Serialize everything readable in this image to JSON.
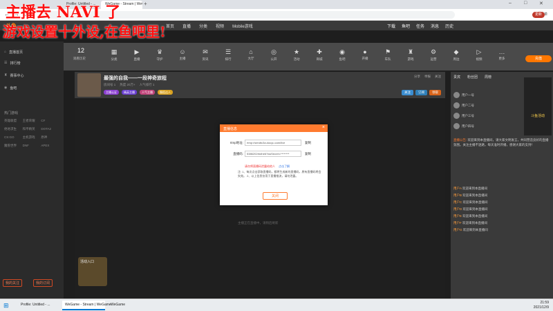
{
  "overlay": {
    "line1": "主播去 NAVI 了",
    "line2": "游戏设置十外设,在鱼吧里!"
  },
  "browser": {
    "tabs": [
      "Profile: Untitled - ...",
      "WeGame - Stream | WeGame"
    ],
    "new_tab": "+",
    "reader_mode": "阅读清单",
    "profile": "更新"
  },
  "site": {
    "logo": "斗鱼",
    "nav_links": [
      "首页",
      "直播",
      "分类",
      "视频",
      "Mobile游戏"
    ],
    "nav_icons": [
      "下载",
      "鱼吧",
      "任务",
      "消息",
      "历史"
    ]
  },
  "sidebar": {
    "items": [
      "直播首页",
      "排行榜",
      "赛事中心",
      "鱼吧"
    ],
    "section_label": "热门游戏",
    "games": [
      "英雄联盟",
      "王者荣耀",
      "CF",
      "绝地求生",
      "和平精英",
      "DOTA2",
      "CS:GO",
      "主机游戏",
      "原神",
      "魔兽世界",
      "DNF",
      "APEX"
    ],
    "btn_left": "我的关注",
    "btn_right": "我的订阅"
  },
  "category": {
    "count": "12",
    "count_label": "观看历史",
    "items": [
      "分类",
      "直播",
      "守护",
      "主播",
      "资讯",
      "排行",
      "大厅",
      "公开",
      "活动",
      "商城",
      "鱼吧",
      "开播",
      "车队",
      "游戏",
      "运营",
      "周边",
      "视频",
      "更多"
    ],
    "recharge": "充值"
  },
  "room": {
    "title": "最强的自我——一段神奇旅程",
    "meta": [
      "房间号 1",
      "热度 20万+",
      "人气排行 1"
    ],
    "tags": [
      "主播认证",
      "精英主播",
      "人气主播",
      "舞蹈达人"
    ],
    "right_links": [
      "分享",
      "举报",
      "关注"
    ],
    "buttons": [
      "关注",
      "订阅",
      "领取"
    ]
  },
  "video": {
    "hint": "主播正在直播中，请稍后刷新",
    "promo_label": "活动入口"
  },
  "dialog": {
    "title": "直播信息",
    "close_icon": "×",
    "rtmp_label": "rtmp地址:",
    "rtmp_value": "rtmp://sendtc3a.douyu.com/live",
    "key_label": "直播码:",
    "key_value": "5386202rbdhe6?wsSecret=********",
    "copy_label": "复制",
    "warning": "请勿将直播码泄露给他人",
    "warning_link": "点击了解",
    "notes": "注: 1、每次点击获取直播码，都将生成新的直播码，原有直播码将会失效。 2、以上信息仅用于直播推流，请勿泄露。",
    "confirm": "关闭"
  },
  "rightpanel": {
    "tabs": [
      "贵宾",
      "粉丝团",
      "周榜"
    ],
    "ranks": [
      "用户一号",
      "用户二号",
      "用户三号",
      "用户四号"
    ],
    "ad": "斗鱼活动",
    "announcement_label": "直播公告:",
    "announcement": "欢迎来到本直播间，请大家文明发言，共同营造良好的直播氛围。关注主播不迷路，每天准时开播，感谢大家的支持！",
    "chat": [
      {
        "user": "用户A",
        "text": "欢迎来到本直播间"
      },
      {
        "user": "用户B",
        "text": "欢迎来到本直播间"
      },
      {
        "user": "用户C",
        "text": "欢迎来到本直播间"
      },
      {
        "user": "用户D",
        "text": "欢迎来到本直播间"
      },
      {
        "user": "用户E",
        "text": "欢迎来到本直播间"
      },
      {
        "user": "用户F",
        "text": "欢迎来到本直播间"
      },
      {
        "user": "用户G",
        "text": "欢迎来到本直播间"
      }
    ]
  },
  "taskbar": {
    "tasks": [
      "Profile: Untitled - ...",
      "WeGame - Stream | WeGame",
      "WeGame"
    ],
    "time": "21:59",
    "date": "2021/12/9"
  }
}
